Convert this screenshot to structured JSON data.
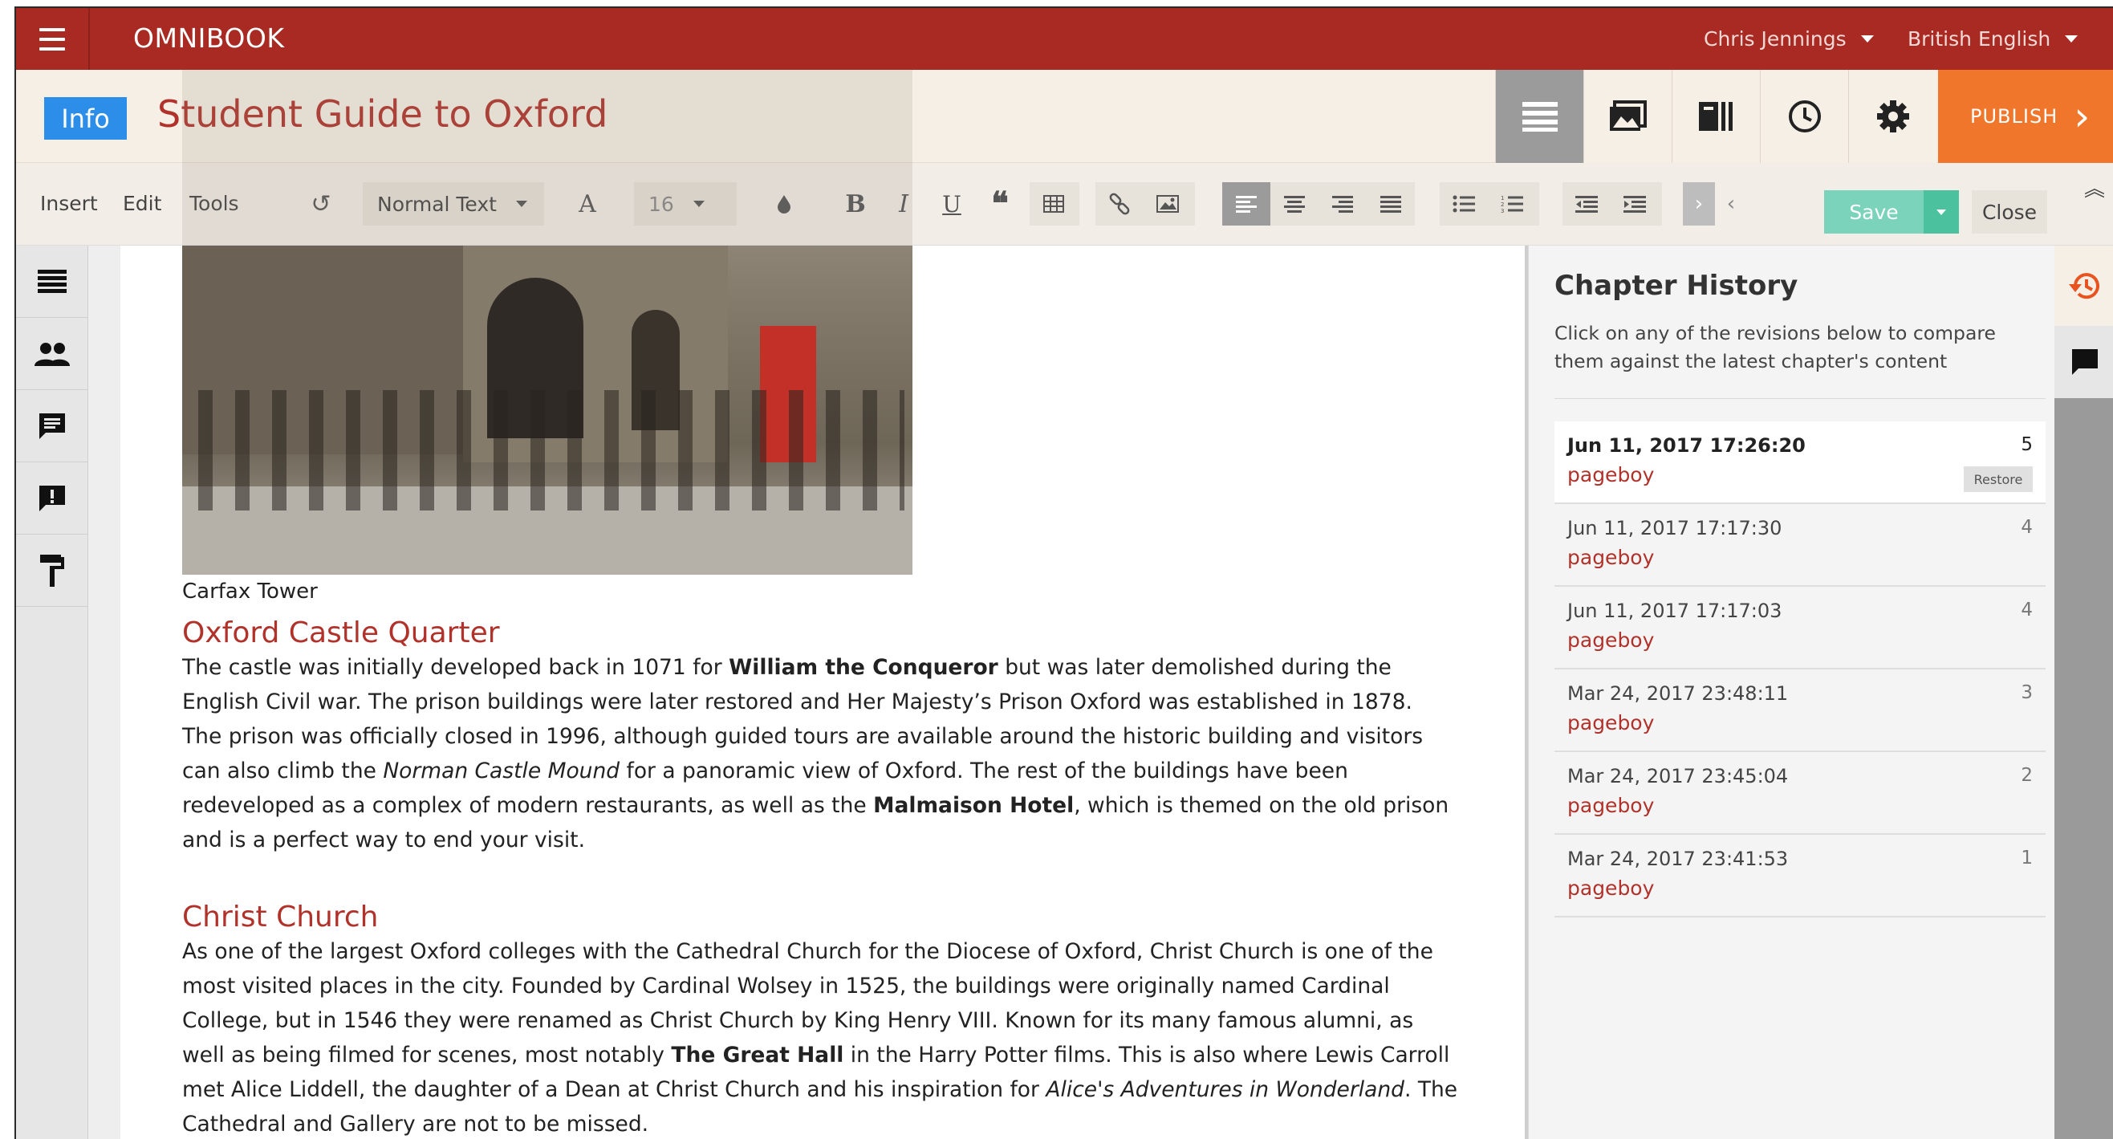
{
  "app": {
    "brand": "OMNIBOOK"
  },
  "header": {
    "user_name": "Chris Jennings",
    "language": "British English"
  },
  "document": {
    "info_label": "Info",
    "title": "Student Guide to Oxford",
    "publish_label": "PUBLISH"
  },
  "toolbar": {
    "menus": [
      "Insert",
      "Edit",
      "Tools"
    ],
    "text_style": "Normal Text",
    "font_size": "16",
    "save_label": "Save",
    "close_label": "Close"
  },
  "content": {
    "caption": "Carfax Tower",
    "section1_title": "Oxford Castle Quarter",
    "section1_p1": "The castle was initially developed back in 1071 for ",
    "section1_b1": "William the Conqueror",
    "section1_p2": " but was later demolished during the English Civil war. The prison buildings were later restored and Her Majesty’s Prison Oxford was established in 1878. The prison was officially closed in 1996, although guided tours are available around the historic building and visitors can also climb the ",
    "section1_i1": "Norman Castle Mound",
    "section1_p3": " for a panoramic view of Oxford. The rest of the buildings have been redeveloped as a complex of modern restaurants, as well as the ",
    "section1_b2": "Malmaison Hotel",
    "section1_p4": ", which is themed on the old prison and is a perfect way to end your visit.",
    "section2_title": "Christ Church",
    "section2_p1": "As one of the largest Oxford colleges with the Cathedral Church for the Diocese of Oxford, Christ Church is one of the most visited places in the city. Founded by Cardinal Wolsey in 1525, the buildings were originally named Cardinal College, but in 1546 they were renamed as Christ Church by King Henry VIII. Known for its many famous alumni, as well as being filmed for scenes, most notably ",
    "section2_b1": "The Great Hall",
    "section2_p2": " in the Harry Potter films. This is also where Lewis Carroll met Alice Liddell, the daughter of a Dean at Christ Church and his inspiration for ",
    "section2_i1": "Alice's Adventures in Wonderland",
    "section2_p3": ". The Cathedral and Gallery are not to be missed."
  },
  "history": {
    "title": "Chapter History",
    "subtitle": "Click on any of the revisions below to compare them against the latest chapter's content",
    "restore_label": "Restore",
    "revisions": [
      {
        "date": "Jun 11, 2017 17:26:20",
        "author": "pageboy",
        "num": "5"
      },
      {
        "date": "Jun 11, 2017 17:17:30",
        "author": "pageboy",
        "num": "4"
      },
      {
        "date": "Jun 11, 2017 17:17:03",
        "author": "pageboy",
        "num": "4"
      },
      {
        "date": "Mar 24, 2017 23:48:11",
        "author": "pageboy",
        "num": "3"
      },
      {
        "date": "Mar 24, 2017 23:45:04",
        "author": "pageboy",
        "num": "2"
      },
      {
        "date": "Mar 24, 2017 23:41:53",
        "author": "pageboy",
        "num": "1"
      }
    ]
  },
  "colors": {
    "topbar": "#a82a23",
    "accent_red": "#b0322a",
    "publish": "#f0762b",
    "save": "#7ad3ba",
    "info": "#2c8ee8"
  }
}
